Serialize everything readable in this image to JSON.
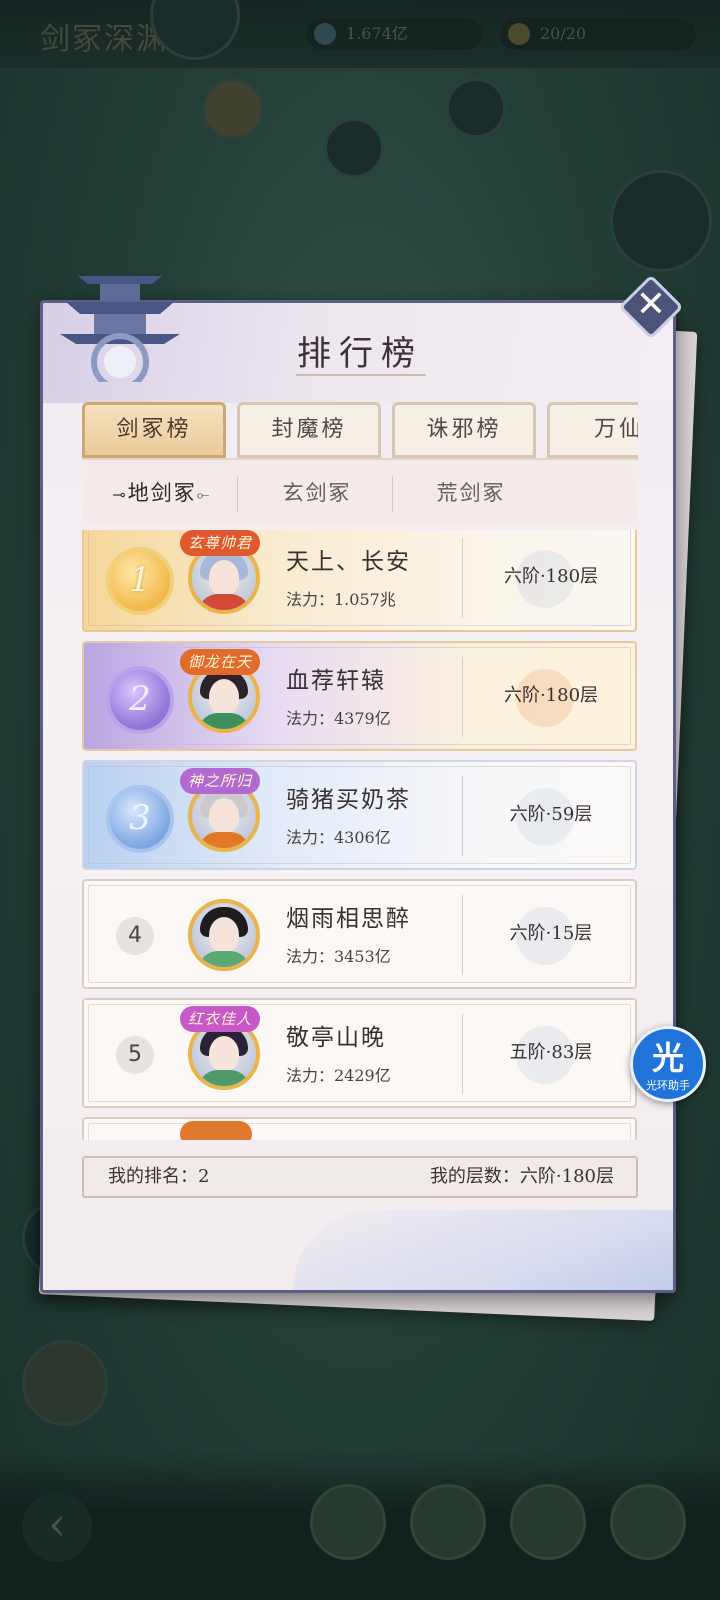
{
  "background": {
    "map_title": "剑冢深渊·7",
    "resource_1": "1.674亿",
    "resource_2": "20/20",
    "back_icon": "back-arrow-icon"
  },
  "panel": {
    "title": "排行榜",
    "close_icon": "close-icon"
  },
  "tabs": [
    {
      "label": "剑冢榜",
      "active": true
    },
    {
      "label": "封魔榜",
      "active": false
    },
    {
      "label": "诛邪榜",
      "active": false
    },
    {
      "label": "万仙",
      "active": false
    }
  ],
  "subtabs": [
    {
      "label": "地剑冢",
      "active": true
    },
    {
      "label": "玄剑冢",
      "active": false
    },
    {
      "label": "荒剑冢",
      "active": false
    }
  ],
  "rankings": [
    {
      "rank": "1",
      "badge": "玄尊帅君",
      "name": "天上、长安",
      "power": "法力：1.057兆",
      "floor": "六阶·180层"
    },
    {
      "rank": "2",
      "badge": "御龙在天",
      "name": "血荐轩辕",
      "power": "法力：4379亿",
      "floor": "六阶·180层"
    },
    {
      "rank": "3",
      "badge": "神之所归",
      "name": "骑猪买奶茶",
      "power": "法力：4306亿",
      "floor": "六阶·59层"
    },
    {
      "rank": "4",
      "badge": "",
      "name": "烟雨相思醉",
      "power": "法力：3453亿",
      "floor": "六阶·15层"
    },
    {
      "rank": "5",
      "badge": "红衣佳人",
      "name": "敬亭山晚",
      "power": "法力：2429亿",
      "floor": "五阶·83层"
    }
  ],
  "my_status": {
    "rank_text": "我的排名：2",
    "floor_text": "我的层数：六阶·180层"
  },
  "helper": {
    "glyph": "光",
    "label": "光环助手"
  },
  "colors": {
    "panel_border": "#5b5f84",
    "tab_active": "#eacb98",
    "rank1": "#f1b94c",
    "rank2": "#8d74d6",
    "rank3": "#7ea6e0",
    "helper": "#1f73d9"
  }
}
